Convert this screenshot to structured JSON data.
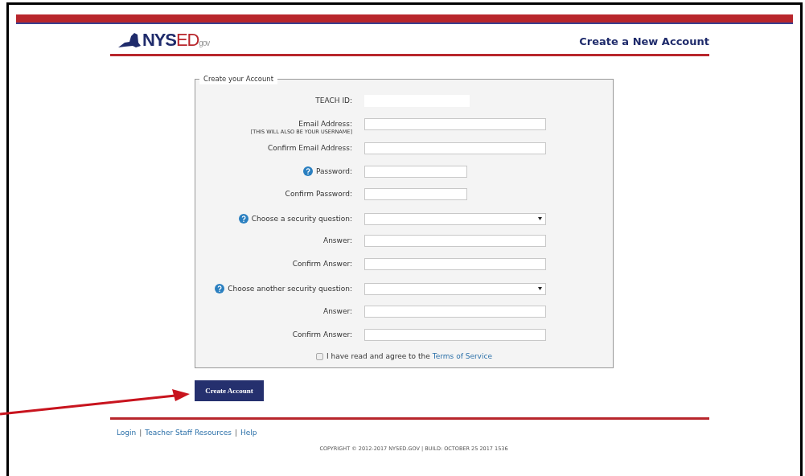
{
  "logo": {
    "parts": [
      "NYS",
      "ED"
    ],
    "suffix": "gov"
  },
  "page_title": "Create a New Account",
  "form": {
    "legend": "Create your Account",
    "rows": [
      {
        "kind": "id",
        "label": "TEACH ID:",
        "help": false
      },
      {
        "kind": "text",
        "label": "Email Address:",
        "sublabel": "[THIS WILL ALSO BE YOUR USERNAME]",
        "help": false
      },
      {
        "kind": "text",
        "label": "Confirm Email Address:",
        "help": false
      },
      {
        "kind": "password",
        "label": "Password:",
        "help": true
      },
      {
        "kind": "password",
        "label": "Confirm Password:",
        "help": false
      },
      {
        "kind": "select",
        "label": "Choose a security question:",
        "help": true
      },
      {
        "kind": "text",
        "label": "Answer:",
        "help": false
      },
      {
        "kind": "text",
        "label": "Confirm Answer:",
        "help": false
      },
      {
        "kind": "select",
        "label": "Choose another security question:",
        "help": true
      },
      {
        "kind": "text",
        "label": "Answer:",
        "help": false
      },
      {
        "kind": "text",
        "label": "Confirm Answer:",
        "help": false
      }
    ],
    "agree": {
      "text": "I have read and agree to the",
      "link": "Terms of Service",
      "checked": false
    }
  },
  "submit": "Create Account",
  "footer": {
    "links": [
      "Login",
      "Teacher Staff Resources",
      "Help"
    ],
    "separator": "|",
    "copyright": "COPYRIGHT © 2012-2017 NYSED.GOV | BUILD: OCTOBER 25 2017 1536"
  }
}
